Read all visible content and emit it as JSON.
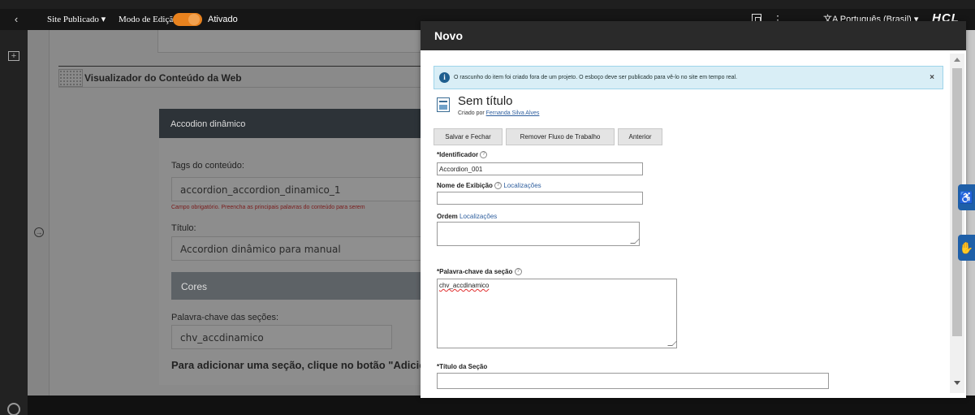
{
  "topbar": {
    "back": "‹",
    "site_menu": "Site Publicado",
    "edit_mode_label": "Modo de Edição:",
    "toggle_label": "Ativado",
    "language": "Português (Brasil)",
    "logo": "HCL",
    "accent_color": "#e8821e"
  },
  "page": {
    "viewer_title": "Visualizador do Conteúdo da Web",
    "card_header": "Accodion dinâmico",
    "tags_label": "Tags do conteúdo:",
    "tags_value": "accordion_accordion_dinamico_1",
    "tags_error": "Campo obrigatório. Preencha as principais palavras do conteúdo para serem",
    "title_label": "Título:",
    "title_value": "Accordion dinâmico para manual",
    "cores_label": "Cores",
    "sections_keyword_label": "Palavra-chave das seções:",
    "sections_keyword_value": "chv_accdinamico",
    "add_section_text": "Para adicionar uma seção, clique no botão \"Adicio"
  },
  "modal": {
    "title": "Novo",
    "alert": "O rascunho do item foi criado fora de um projeto. O esboço deve ser publicado para vê-lo no site em tempo real.",
    "alert_close": "×",
    "item_title": "Sem título",
    "created_by_prefix": "Criado por",
    "created_by_user": "Fernanda Silva Alves",
    "buttons": {
      "save_close": "Salvar e Fechar",
      "remove_workflow": "Remover Fluxo de Trabalho",
      "previous": "Anterior"
    },
    "fields": {
      "identifier_label": "*Identificador",
      "identifier_value": "Accordion_001",
      "display_name_label": "Nome de Exibição",
      "display_name_link": "Localizações",
      "display_name_value": "",
      "order_label": "Ordem",
      "order_link": "Localizações",
      "order_value": "",
      "section_keyword_label": "*Palavra-chave da seção",
      "section_keyword_value": "chv_accdinamico",
      "section_title_label": "*Título da Seção",
      "section_title_value": ""
    }
  }
}
